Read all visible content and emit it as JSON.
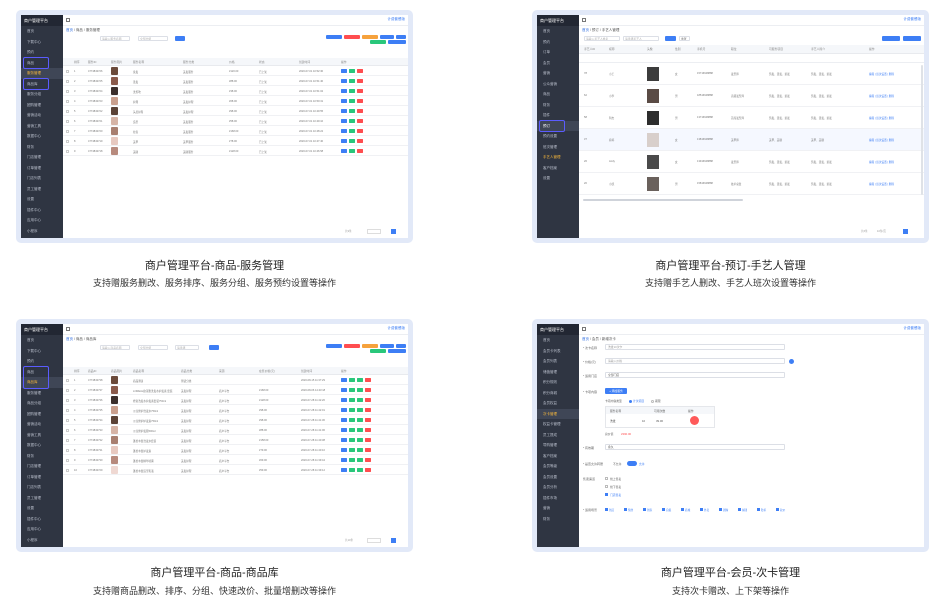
{
  "colors": {
    "accent": "#3d7ef5",
    "selection": "#5b5cff",
    "sidebar": "#2f3542",
    "danger": "#ff4d4f",
    "success": "#29c77b",
    "warn": "#f6a23c",
    "frame": "#e2e9f8"
  },
  "card1": {
    "title": "商户管理平台-商品-服务管理",
    "subtitle": "支持赠服务删改、服务排序、服务分组、服务预约设置等操作",
    "app": {
      "brand": "商户管理平台",
      "topbar_right": "计费套餐版"
    },
    "breadcrumb": [
      "首页",
      "商品",
      "服务管理"
    ],
    "sidebar": [
      "首页",
      "下载中心",
      "预约",
      "商品",
      "服务管理",
      "商品库",
      "服务分组",
      "团购管理",
      "营销活动",
      "营销工具",
      "数据中心",
      "财务",
      "门店管理",
      "订单管理",
      "门店列表",
      "员工管理",
      "设置",
      "插件中心",
      "应用中心",
      "小程序",
      "系统管理"
    ],
    "filters": {
      "search_placeholder": "请输入服务名称",
      "select_placeholder": "全部分组",
      "query": "查询"
    },
    "columns": [
      "排序",
      "服务ID",
      "服务图片",
      "服务名称",
      "服务分类",
      "价格",
      "状态",
      "创建时间",
      "操作"
    ],
    "rows": [
      {
        "id": "4774843726",
        "name": "染发",
        "category": "美发服务",
        "price": "¥120.00",
        "status": "已上架",
        "time": "2020-07-01 10:52:30"
      },
      {
        "id": "4774843725",
        "name": "烫发",
        "category": "美发服务",
        "price": "¥88.00",
        "status": "已上架",
        "time": "2020-07-01 10:51:40"
      },
      {
        "id": "4774843724",
        "name": "洗剪吹",
        "category": "美发服务",
        "price": "¥38.00",
        "status": "已上架",
        "time": "2020-07-01 10:51:02"
      },
      {
        "id": "4774843723",
        "name": "护理",
        "category": "美发护理",
        "price": "¥68.00",
        "status": "已上架",
        "time": "2020-07-01 10:50:31"
      },
      {
        "id": "4774843722",
        "name": "头皮护理",
        "category": "美发护理",
        "price": "¥98.00",
        "status": "已上架",
        "time": "2020-07-01 10:49:55"
      },
      {
        "id": "4774843721",
        "name": "造型",
        "category": "美发服务",
        "price": "¥58.00",
        "status": "已上架",
        "time": "2020-07-01 10:49:10"
      },
      {
        "id": "4774843720",
        "name": "拉直",
        "category": "美发服务",
        "price": "¥168.00",
        "status": "已上架",
        "time": "2020-07-01 10:48:22"
      },
      {
        "id": "4774843719",
        "name": "美甲",
        "category": "美甲服务",
        "price": "¥78.00",
        "status": "已上架",
        "time": "2020-07-01 10:47:40"
      },
      {
        "id": "4774843718",
        "name": "美睫",
        "category": "美睫服务",
        "price": "¥128.00",
        "status": "已上架",
        "time": "2020-07-01 10:46:58"
      }
    ]
  },
  "card2": {
    "title": "商户管理平台-预订-手艺人管理",
    "subtitle": "支持赠手艺人删改、手艺人班次设置等操作",
    "app": {
      "brand": "商户管理平台",
      "topbar_right": "计费套餐版"
    },
    "breadcrumb": [
      "首页",
      "预订",
      "手艺人管理"
    ],
    "sidebar": [
      "首页",
      "预约",
      "订单",
      "会员",
      "营销",
      "公众营销",
      "商品",
      "财务",
      "插件",
      "预订",
      "预约设置",
      "班次管理",
      "手艺人管理",
      "客户档案",
      "设置"
    ],
    "filters": {
      "search_placeholder": "请输入手艺人姓名",
      "select_placeholder": "请选择手艺人",
      "query": "查询",
      "reset": "重置",
      "add": "添加手艺人",
      "batch": "批量操作"
    },
    "columns": [
      "手艺人ID",
      "昵称",
      "头像",
      "性别",
      "手机号",
      "职位",
      "可服务项目",
      "手艺人简介",
      "操作"
    ],
    "rows": [
      {
        "id": "78",
        "nick": "小王",
        "gender": "女",
        "phone": "15716648888",
        "title": "发型师",
        "desc": "剪发、烫发、染发"
      },
      {
        "id": "62",
        "nick": "小李",
        "gender": "男",
        "phone": "18516648888",
        "title": "高级发型师",
        "desc": "剪发、烫发、染发"
      },
      {
        "id": "58",
        "nick": "阿杰",
        "gender": "男",
        "phone": "13716648888",
        "title": "首席发型师",
        "desc": "剪发、烫发、染发"
      },
      {
        "id": "37",
        "nick": "婷婷",
        "gender": "女",
        "phone": "13816648888",
        "title": "美甲师",
        "desc": "美甲、美睫"
      },
      {
        "id": "26",
        "nick": "Andy",
        "gender": "女",
        "phone": "13916648888",
        "title": "发型师",
        "desc": "剪发、烫发、染发"
      },
      {
        "id": "20",
        "nick": "小凯",
        "gender": "男",
        "phone": "15816648888",
        "title": "技术总监",
        "desc": "剪发、烫发、染发"
      }
    ],
    "op_text": "编辑 | 班次设置 | 删除"
  },
  "card3": {
    "title": "商户管理平台-商品-商品库",
    "subtitle": "支持赠商品删改、排序、分组、快速改价、批量增删改等操作",
    "app": {
      "brand": "商户管理平台",
      "topbar_right": "计费套餐版"
    },
    "breadcrumb": [
      "首页",
      "商品",
      "商品库"
    ],
    "sidebar": [
      "首页",
      "下载中心",
      "预约",
      "商品",
      "商品库",
      "服务管理",
      "商品分组",
      "团购管理",
      "营销活动",
      "营销工具",
      "数据中心",
      "财务",
      "门店管理",
      "订单管理",
      "门店列表",
      "员工管理",
      "设置",
      "插件中心",
      "应用中心",
      "小程序",
      "系统管理"
    ],
    "filters": {
      "search_placeholder": "请输入商品名称",
      "select_placeholder": "全部分组",
      "select2_placeholder": "请选择",
      "query": "查询"
    },
    "columns": [
      "排序",
      "商品ID",
      "商品图片",
      "商品名称",
      "商品分类",
      "来源",
      "在售价格(元)",
      "创建时间",
      "操作"
    ],
    "rows": [
      {
        "id": "4774843738",
        "name": "商品测试",
        "category": "测试分类",
        "source": "",
        "price": "",
        "time": "2020-08-15 11:37:29"
      },
      {
        "id": "4774843737",
        "name": "LOREAL欧莱雅洗发水护发素 套装",
        "category": "美发护理",
        "source": "商户平台",
        "price": "¥168.00",
        "time": "2020-08-06 14:43:18"
      },
      {
        "id": "4774843736",
        "name": "修复洗发水护发素套装750ml",
        "category": "美发护理",
        "source": "商户平台",
        "price": "¥128.00",
        "time": "2020-07-28 11:42:20"
      },
      {
        "id": "4774843735",
        "name": "沙龙修护洗发水750ml",
        "category": "美发护理",
        "source": "商户平台",
        "price": "¥98.00",
        "time": "2020-07-28 11:42:01"
      },
      {
        "id": "4774843734",
        "name": "沙龙修护护发素750ml",
        "category": "美发护理",
        "source": "商户平台",
        "price": "¥98.00",
        "time": "2020-07-28 11:41:30"
      },
      {
        "id": "4774843733",
        "name": "沙龙修护发膜500ml",
        "category": "美发护理",
        "source": "商户平台",
        "price": "¥88.00",
        "time": "2020-07-28 11:41:06"
      },
      {
        "id": "4774843732",
        "name": "蓬松丰盈洗发水套装",
        "category": "美发护理",
        "source": "商户平台",
        "price": "¥158.00",
        "time": "2020-07-28 11:40:38"
      },
      {
        "id": "4774843731",
        "name": "蓬松丰盈护发素",
        "category": "美发护理",
        "source": "商户平台",
        "price": "¥79.00",
        "time": "2020-07-28 11:40:10"
      },
      {
        "id": "4774843730",
        "name": "蓬松丰盈精华喷雾",
        "category": "美发护理",
        "source": "商户平台",
        "price": "¥69.00",
        "time": "2020-07-28 11:39:44"
      },
      {
        "id": "4774843729",
        "name": "蓬松丰盈造型乳液",
        "category": "美发护理",
        "source": "商户平台",
        "price": "¥59.00",
        "time": "2020-07-28 11:39:12"
      }
    ]
  },
  "card4": {
    "title": "商户管理平台-会员-次卡管理",
    "subtitle": "支持次卡赠改、上下架等操作",
    "app": {
      "brand": "商户管理平台",
      "topbar_right": "计费套餐版"
    },
    "breadcrumb": [
      "首页",
      "会员",
      "新增次卡"
    ],
    "sidebar": [
      "首页",
      "会员卡列表",
      "会员列表",
      "储值管理",
      "积分规则",
      "积分商城",
      "会员权益",
      "次卡管理",
      "权益卡管理",
      "员工提成",
      "导购管理",
      "客户档案",
      "会员等级",
      "会员设置",
      "会员分析",
      "插件市场",
      "营销",
      "财务"
    ],
    "form": {
      "name_label": "* 次卡名称",
      "name_value": "洗发10次卡",
      "price_label": "* 价格(元)",
      "price_value": "请输入价格",
      "store_label": "* 适用门店",
      "store_value": "全部门店",
      "content_label": "* 卡项内容",
      "add_btn": "+ 添加服务",
      "content_type_label": "卡项内容类型",
      "radio_a": "计次项目",
      "radio_b": "期限",
      "svc_col_name": "服务名称",
      "svc_col_count": "可用次数",
      "svc_col_op": "操作",
      "svc_name": "洗发",
      "svc_count": "10",
      "svc_price": "39.00",
      "total_label": "总价值",
      "total_value": "¥390.00",
      "validity_label": "* 有效期",
      "validity_value": "永久",
      "transfer_label": "* 是否允许转赠",
      "transfer_on": "允许",
      "transfer_off": "不允许",
      "sell_label": "售卖渠道",
      "sell_a": "线上售卖",
      "sell_b": "线下售卖",
      "sell_c": "门店售卖",
      "apply_label": "* 适用场景",
      "apply_items": [
        "到店",
        "预约",
        "到家",
        "自提",
        "商城",
        "外卖",
        "团购",
        "拼团",
        "秒杀",
        "砍价"
      ]
    }
  }
}
